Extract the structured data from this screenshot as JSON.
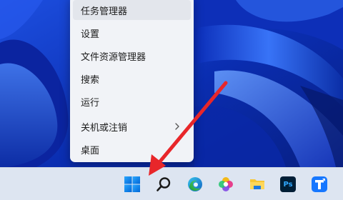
{
  "context_menu": {
    "items": [
      {
        "label": "任务管理器"
      },
      {
        "label": "设置"
      },
      {
        "label": "文件资源管理器"
      },
      {
        "label": "搜索"
      },
      {
        "label": "运行"
      },
      {
        "label": "关机或注销"
      },
      {
        "label": "桌面"
      }
    ]
  },
  "taskbar": {
    "apps": [
      {
        "name": "start-icon"
      },
      {
        "name": "search-icon"
      },
      {
        "name": "edge-icon"
      },
      {
        "name": "photos-icon"
      },
      {
        "name": "file-explorer-icon"
      },
      {
        "name": "photoshop-icon",
        "label": "Ps"
      },
      {
        "name": "app-t-icon"
      }
    ]
  },
  "annotation": {
    "color": "#e8262a"
  },
  "colors": {
    "wallpaper_base": "#0a2a9e",
    "accent": "#0067c0"
  }
}
